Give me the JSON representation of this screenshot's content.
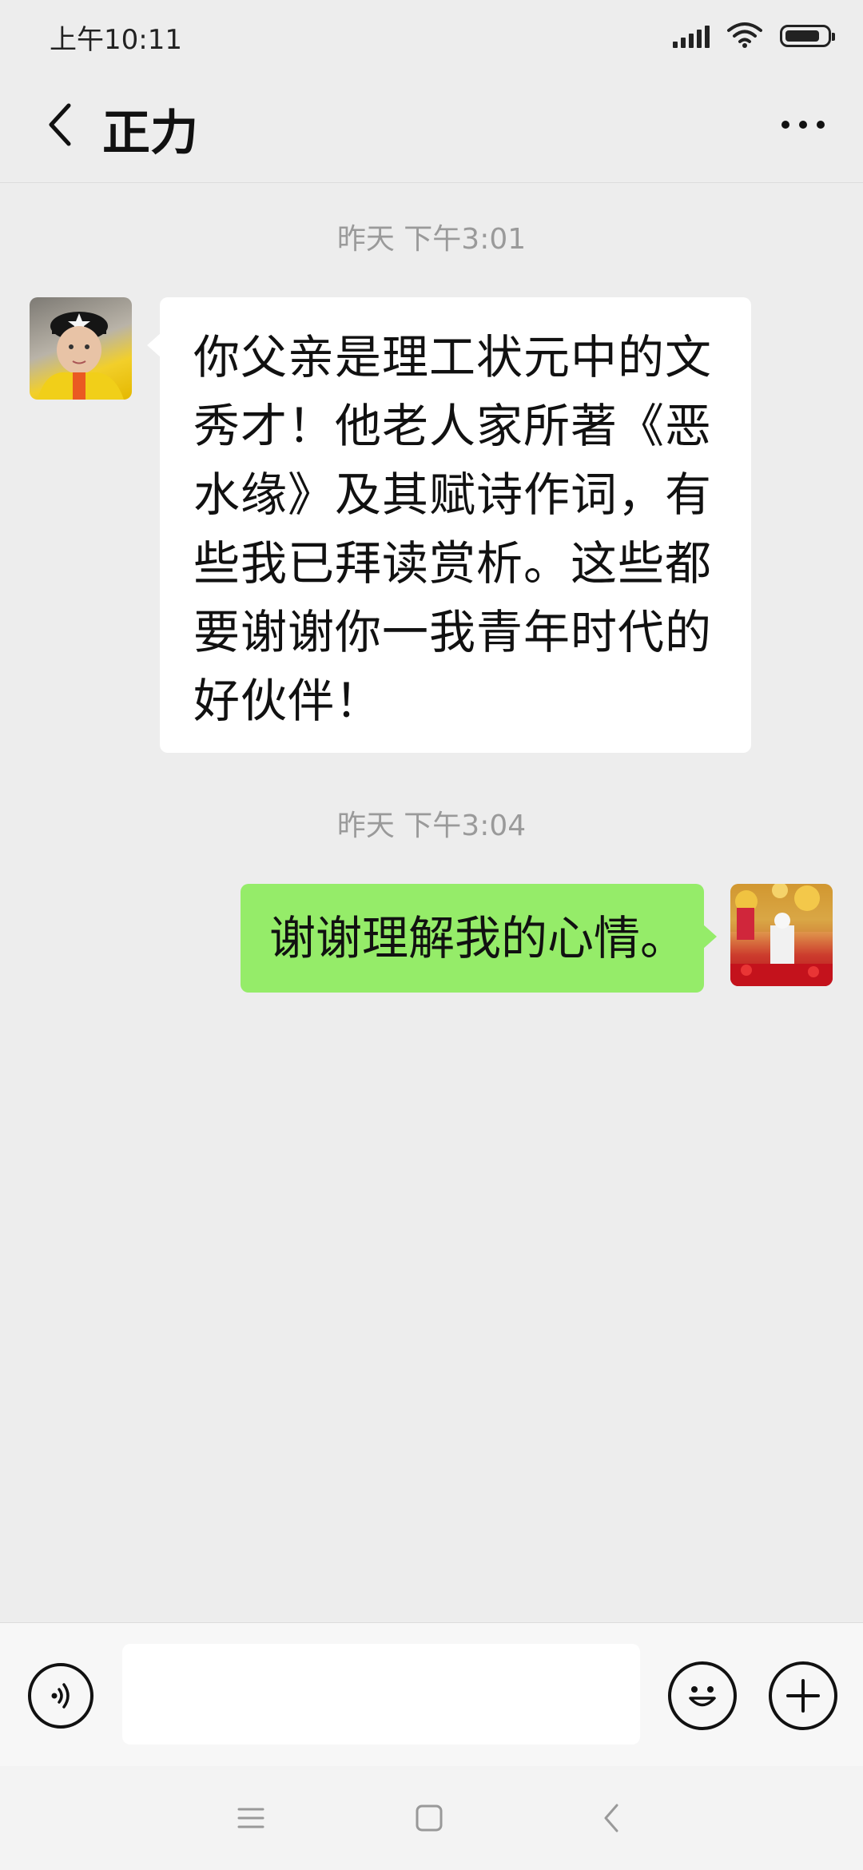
{
  "status_bar": {
    "time": "上午10:11"
  },
  "header": {
    "title": "正力"
  },
  "messages": [
    {
      "timestamp": "昨天 下午3:01",
      "sender": "contact",
      "text": "你父亲是理工状元中的文秀才！他老人家所著《恶水缘》及其赋诗作词，有些我已拜读赏析。这些都要谢谢你一我青年时代的好伙伴！"
    },
    {
      "timestamp": "昨天 下午3:04",
      "sender": "me",
      "text": "谢谢理解我的心情。"
    }
  ],
  "input_bar": {
    "message_value": ""
  },
  "colors": {
    "background": "#ededed",
    "incoming_bubble": "#ffffff",
    "outgoing_bubble": "#95ec69",
    "timestamp_text": "#9a9a9a"
  },
  "icons": {
    "back": "chevron-left-icon",
    "more": "more-dots-icon",
    "voice": "voice-icon",
    "emoji": "emoji-icon",
    "plus": "plus-icon",
    "menu": "menu-icon",
    "home": "home-icon",
    "system_back": "system-back-icon"
  }
}
